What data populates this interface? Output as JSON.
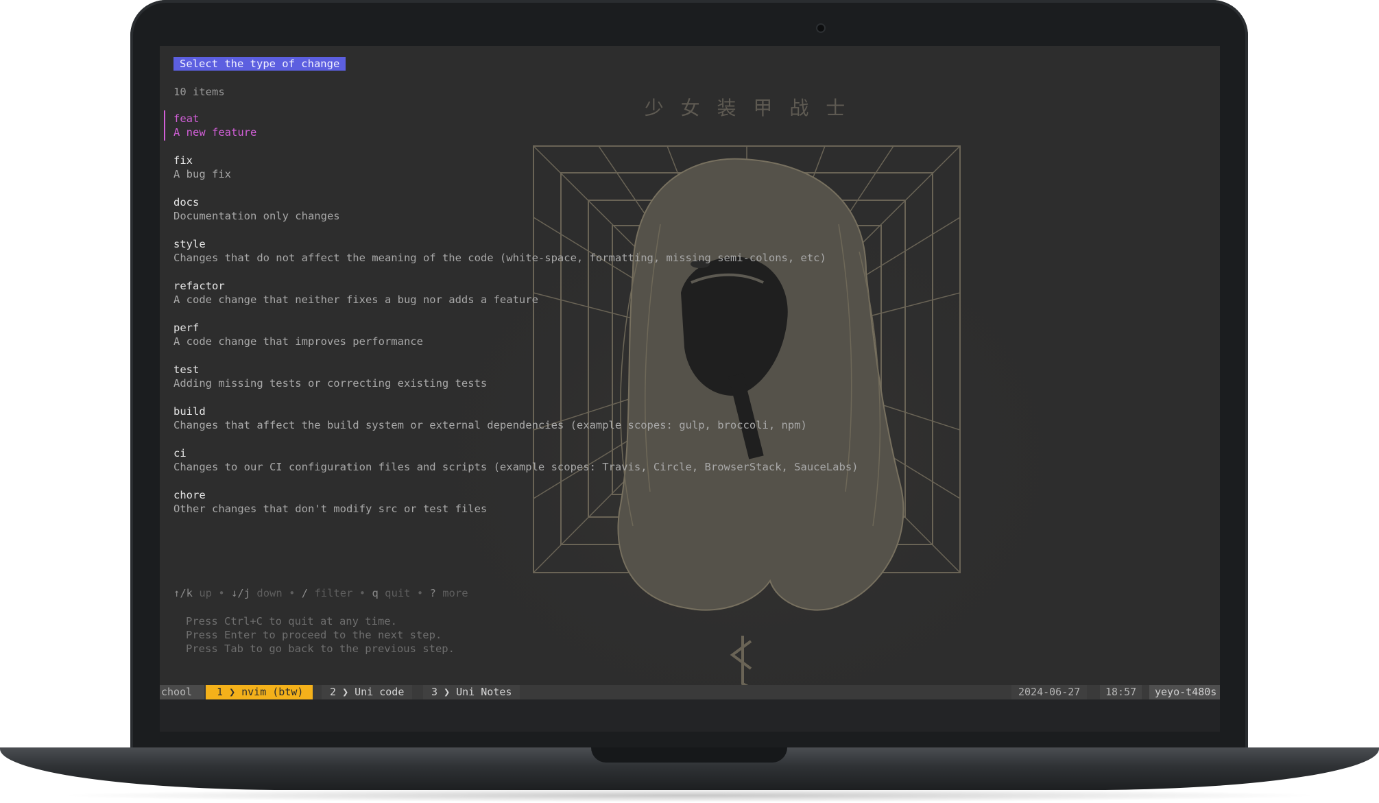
{
  "prompt": {
    "title": "Select the type of change",
    "count_text": "10 items",
    "selected_index": 0,
    "items": [
      {
        "name": "feat",
        "description": "A new feature"
      },
      {
        "name": "fix",
        "description": "A bug fix"
      },
      {
        "name": "docs",
        "description": "Documentation only changes"
      },
      {
        "name": "style",
        "description": "Changes that do not affect the meaning of the code (white-space, formatting, missing semi-colons, etc)"
      },
      {
        "name": "refactor",
        "description": "A code change that neither fixes a bug nor adds a feature"
      },
      {
        "name": "perf",
        "description": "A code change that improves performance"
      },
      {
        "name": "test",
        "description": "Adding missing tests or correcting existing tests"
      },
      {
        "name": "build",
        "description": "Changes that affect the build system or external dependencies (example scopes: gulp, broccoli, npm)"
      },
      {
        "name": "ci",
        "description": "Changes to our CI configuration files and scripts (example scopes: Travis, Circle, BrowserStack, SauceLabs)"
      },
      {
        "name": "chore",
        "description": "Other changes that don't modify src or test files"
      }
    ],
    "help": {
      "up_key": "↑/k",
      "up_label": "up",
      "down_key": "↓/j",
      "down_label": "down",
      "filter_key": "/",
      "filter_label": "filter",
      "quit_key": "q",
      "quit_label": "quit",
      "more_key": "?",
      "more_label": "more",
      "separator": "•"
    },
    "hints": [
      "Press Ctrl+C to quit at any time.",
      "Press Enter to proceed to the next step.",
      "Press Tab to go back to the previous step."
    ]
  },
  "wallpaper": {
    "title": "少 女 装 甲 战 士",
    "colors": {
      "line": "#6a6456",
      "fill": "#54514a",
      "dark": "#202020"
    }
  },
  "statusbar": {
    "session": "chool",
    "windows": [
      {
        "index": "1",
        "name": "nvim (btw)",
        "active": true
      },
      {
        "index": "2",
        "name": "Uni code",
        "active": false
      },
      {
        "index": "3",
        "name": "Uni Notes",
        "active": false
      }
    ],
    "date": "2024-06-27",
    "time": "18:57",
    "host": "yeyo-t480s",
    "colors": {
      "active": "#f4b11a",
      "bar": "#3a3a3a"
    }
  },
  "theme": {
    "selected": "#d25fd8",
    "badge": "#5c5fe0"
  }
}
